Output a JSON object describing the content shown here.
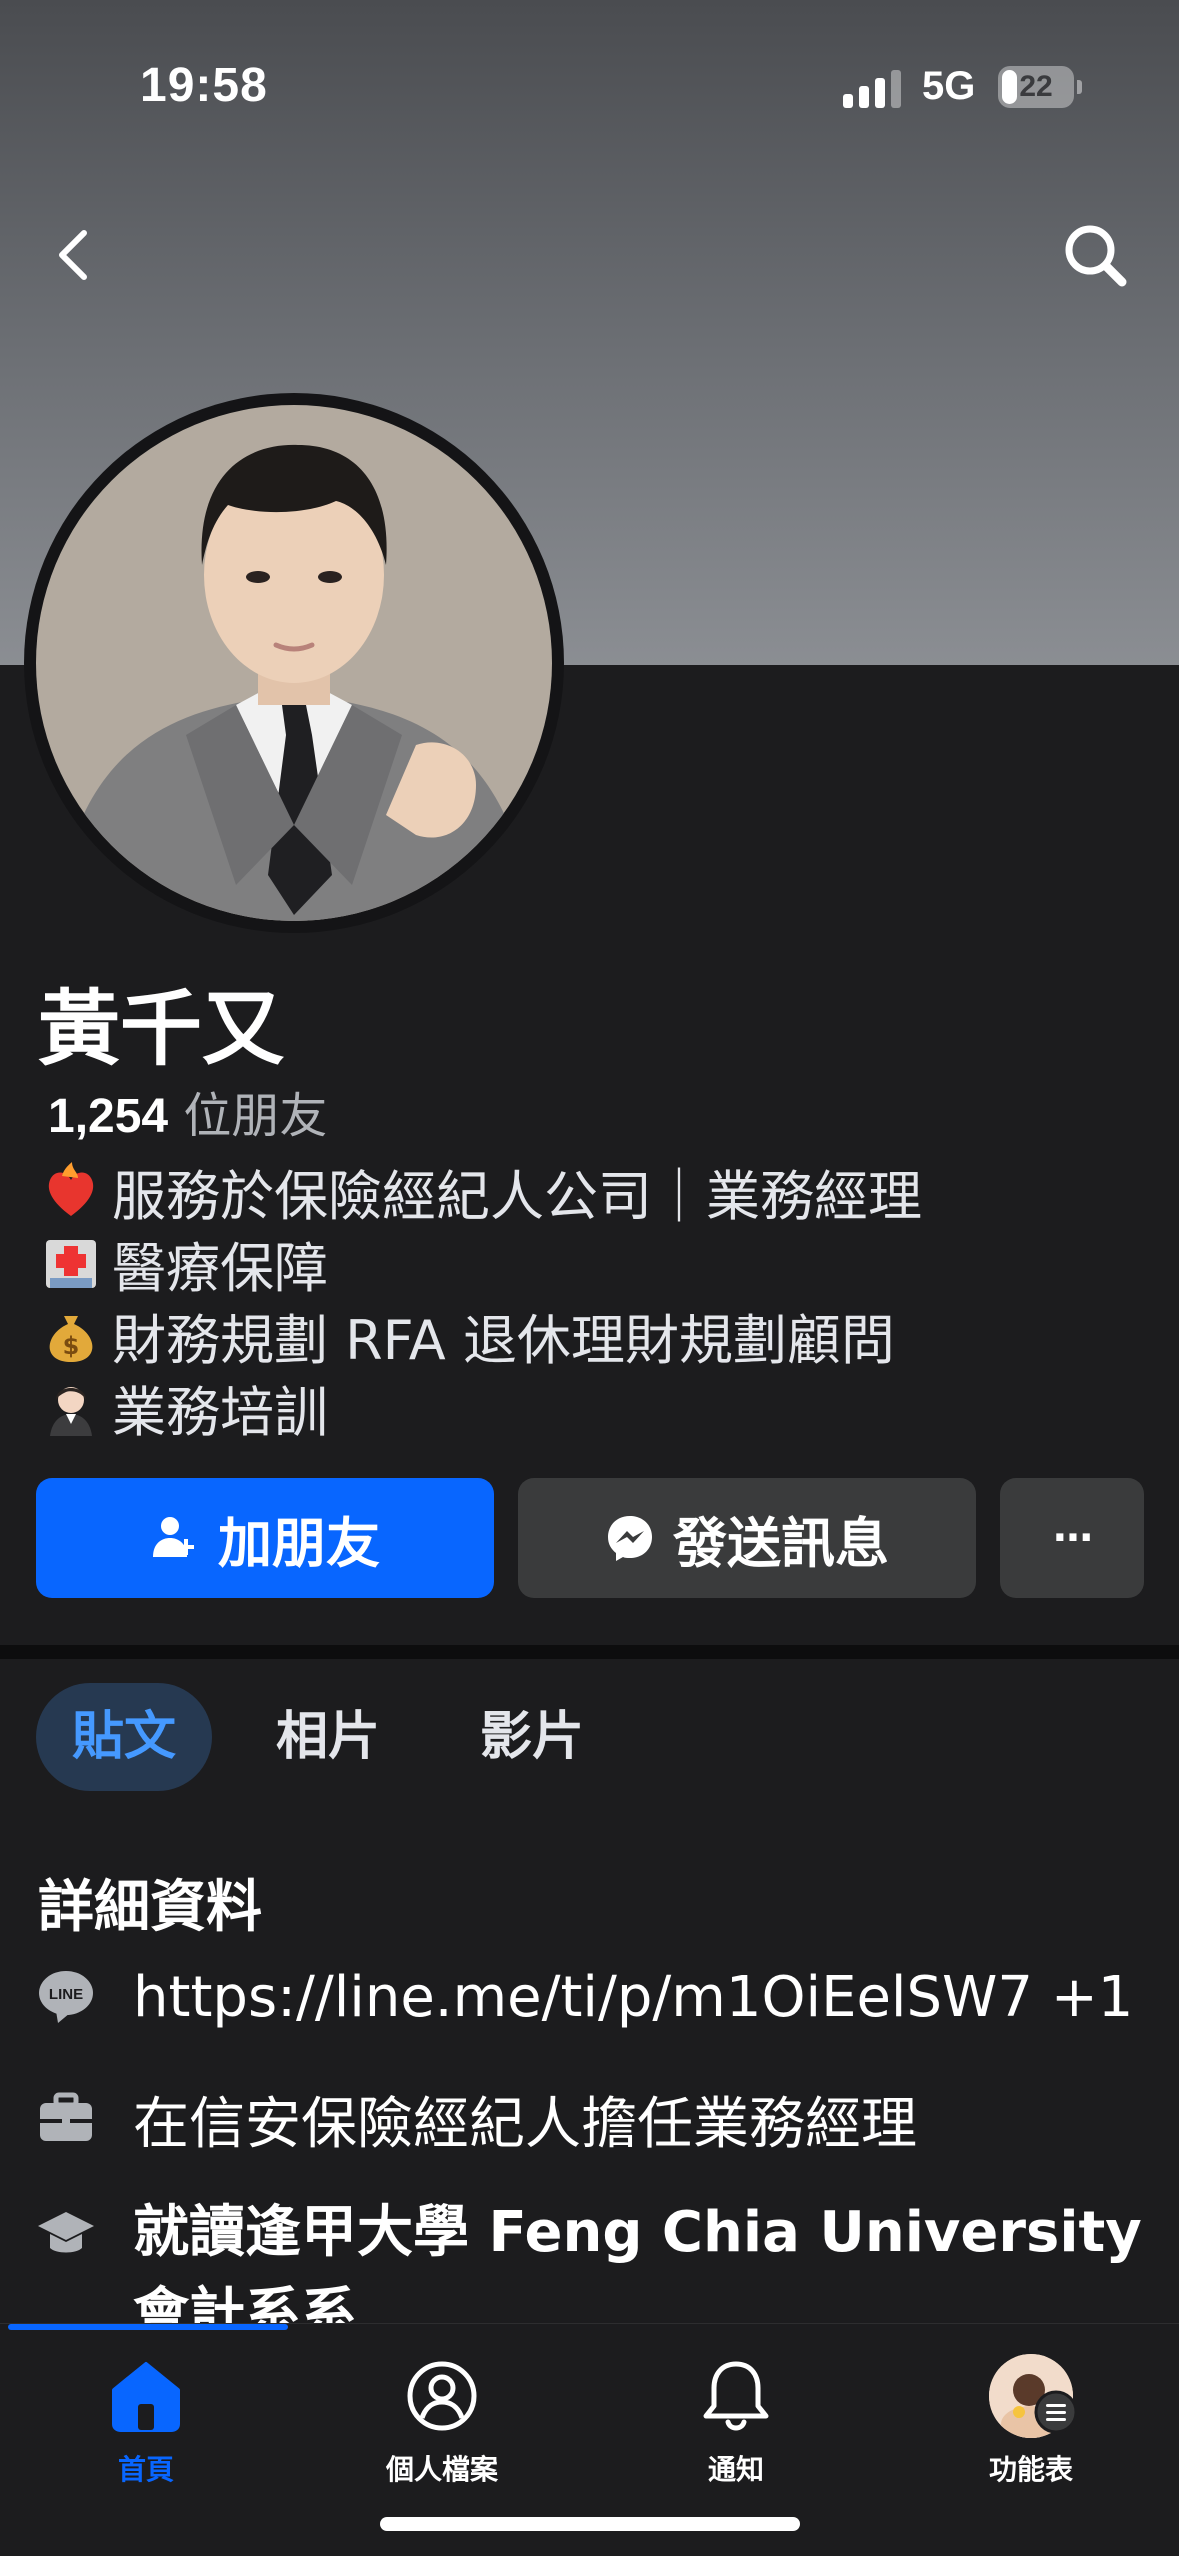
{
  "status_bar": {
    "time": "19:58",
    "network": "5G",
    "battery": "22",
    "battery_level": 0.22
  },
  "profile": {
    "name": "黃千又",
    "friends_count": "1,254",
    "friends_label": "位朋友",
    "bio": [
      {
        "icon": "heart-on-fire-emoji",
        "text": "服務於保險經紀人公司｜業務經理"
      },
      {
        "icon": "hospital-emoji",
        "text": "醫療保障"
      },
      {
        "icon": "money-bag-emoji",
        "text": "財務規劃 RFA 退休理財規劃顧問"
      },
      {
        "icon": "office-worker-emoji",
        "text": "業務培訓"
      }
    ]
  },
  "actions": {
    "add_friend": "加朋友",
    "message": "發送訊息",
    "more": "···"
  },
  "tabs": [
    {
      "label": "貼文",
      "active": true
    },
    {
      "label": "相片",
      "active": false
    },
    {
      "label": "影片",
      "active": false
    }
  ],
  "details": {
    "title": "詳細資料",
    "items": [
      {
        "icon": "line-icon",
        "text": "https://line.me/ti/p/m1OiEelSW7 +1"
      },
      {
        "icon": "briefcase-icon",
        "text": "在信安保險經紀人擔任業務經理"
      },
      {
        "icon": "graduation-cap-icon",
        "text": "就讀逢甲大學 Feng Chia University",
        "text2": "會計系系"
      }
    ]
  },
  "bottom_nav": [
    {
      "label": "首頁",
      "icon": "home-icon",
      "active": true
    },
    {
      "label": "個人檔案",
      "icon": "profile-icon",
      "active": false
    },
    {
      "label": "通知",
      "icon": "bell-icon",
      "active": false
    },
    {
      "label": "功能表",
      "icon": "menu-avatar-icon",
      "active": false
    }
  ],
  "colors": {
    "accent": "#0866ff",
    "background": "#1c1c1e",
    "button_secondary": "#3a3b3c"
  }
}
